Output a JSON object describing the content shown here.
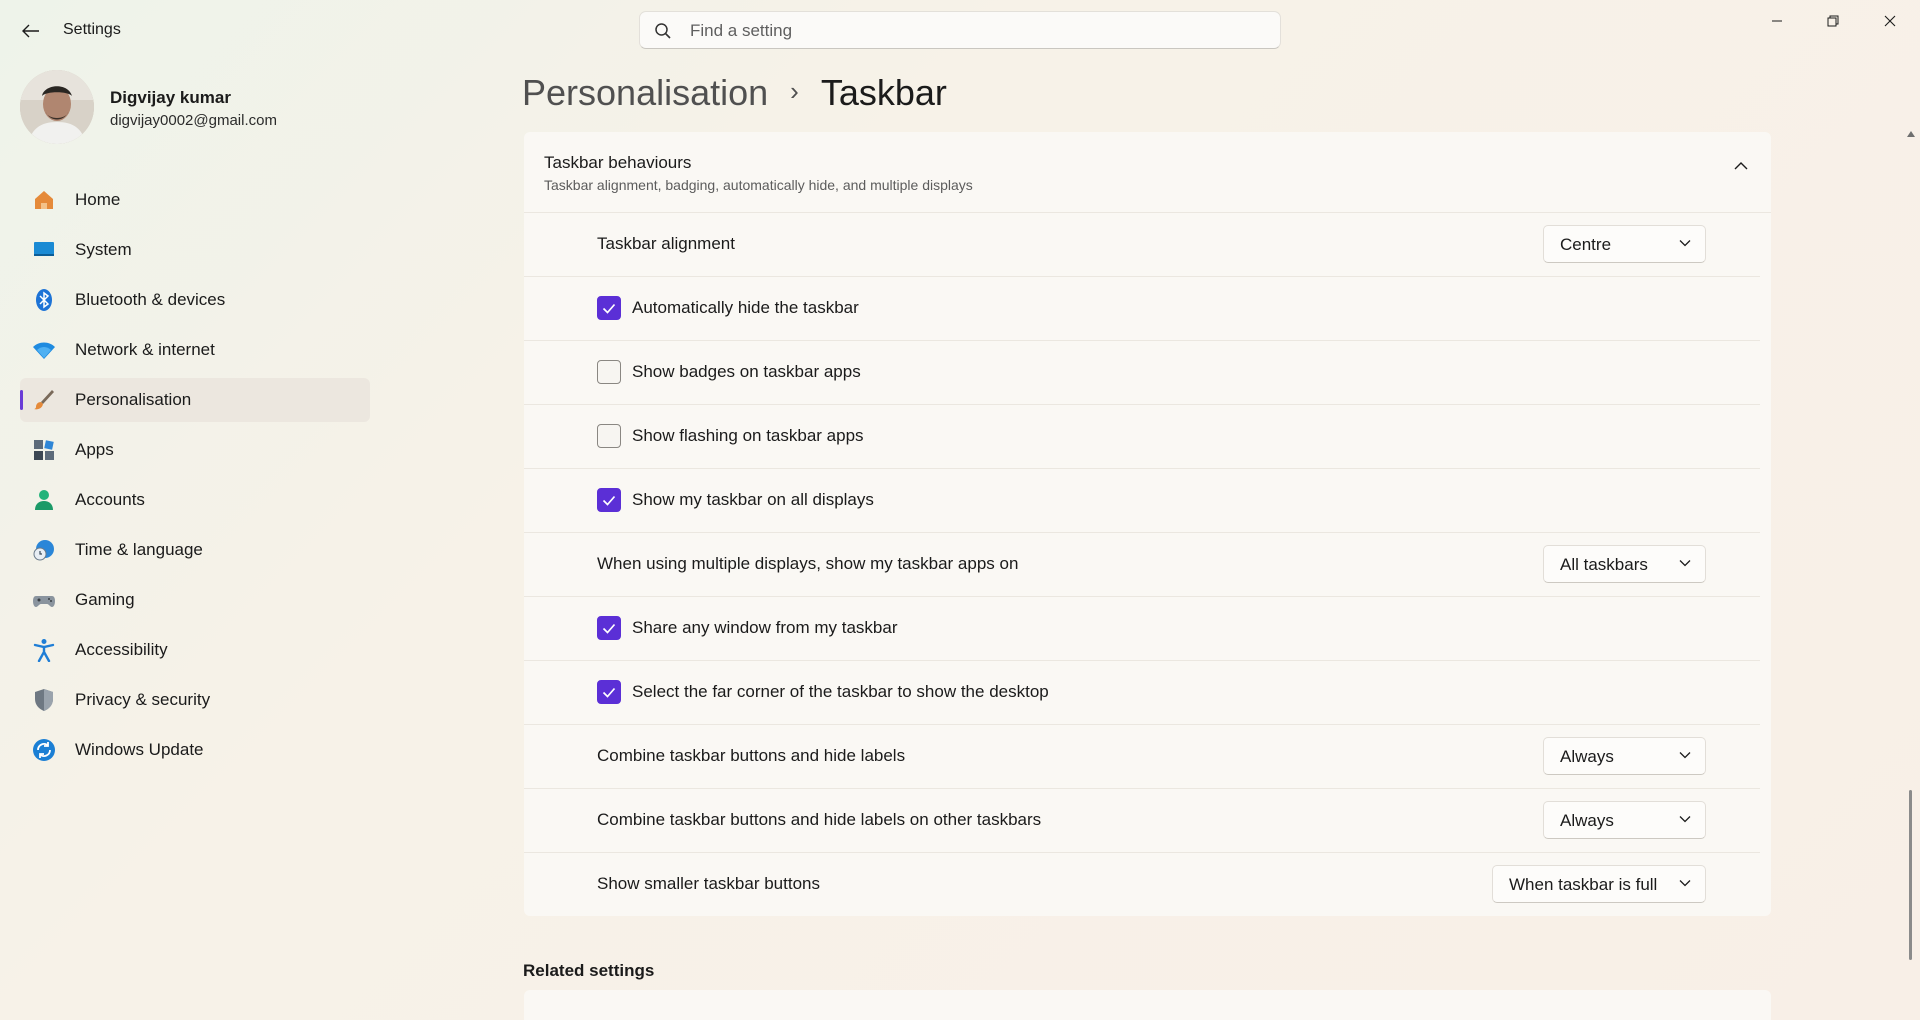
{
  "window": {
    "title": "Settings",
    "search_placeholder": "Find a setting",
    "controls": [
      "minimize-icon",
      "restore-icon",
      "close-icon"
    ]
  },
  "user": {
    "name": "Digvijay kumar",
    "email": "digvijay0002@gmail.com"
  },
  "sidebar": {
    "active_index": 4,
    "accent_color": "#5b2fd6",
    "items": [
      {
        "label": "Home",
        "icon": "home-icon"
      },
      {
        "label": "System",
        "icon": "system-icon"
      },
      {
        "label": "Bluetooth & devices",
        "icon": "bluetooth-icon"
      },
      {
        "label": "Network & internet",
        "icon": "wifi-icon"
      },
      {
        "label": "Personalisation",
        "icon": "brush-icon"
      },
      {
        "label": "Apps",
        "icon": "apps-icon"
      },
      {
        "label": "Accounts",
        "icon": "accounts-icon"
      },
      {
        "label": "Time & language",
        "icon": "clock-globe-icon"
      },
      {
        "label": "Gaming",
        "icon": "gamepad-icon"
      },
      {
        "label": "Accessibility",
        "icon": "accessibility-icon"
      },
      {
        "label": "Privacy & security",
        "icon": "shield-icon"
      },
      {
        "label": "Windows Update",
        "icon": "update-icon"
      }
    ]
  },
  "breadcrumb": {
    "parent": "Personalisation",
    "separator": "›",
    "current": "Taskbar"
  },
  "section": {
    "title": "Taskbar behaviours",
    "subtitle": "Taskbar alignment, badging, automatically hide, and multiple displays",
    "expanded": true
  },
  "settings": [
    {
      "type": "dropdown",
      "label": "Taskbar alignment",
      "value": "Centre"
    },
    {
      "type": "checkbox",
      "label": "Automatically hide the taskbar",
      "checked": true
    },
    {
      "type": "checkbox",
      "label": "Show badges on taskbar apps",
      "checked": false
    },
    {
      "type": "checkbox",
      "label": "Show flashing on taskbar apps",
      "checked": false
    },
    {
      "type": "checkbox",
      "label": "Show my taskbar on all displays",
      "checked": true
    },
    {
      "type": "dropdown",
      "label": "When using multiple displays, show my taskbar apps on",
      "value": "All taskbars"
    },
    {
      "type": "checkbox",
      "label": "Share any window from my taskbar",
      "checked": true
    },
    {
      "type": "checkbox",
      "label": "Select the far corner of the taskbar to show the desktop",
      "checked": true
    },
    {
      "type": "dropdown",
      "label": "Combine taskbar buttons and hide labels",
      "value": "Always"
    },
    {
      "type": "dropdown",
      "label": "Combine taskbar buttons and hide labels on other taskbars",
      "value": "Always"
    },
    {
      "type": "dropdown",
      "label": "Show smaller taskbar buttons",
      "value": "When taskbar is full"
    }
  ],
  "related": {
    "title": "Related settings"
  }
}
